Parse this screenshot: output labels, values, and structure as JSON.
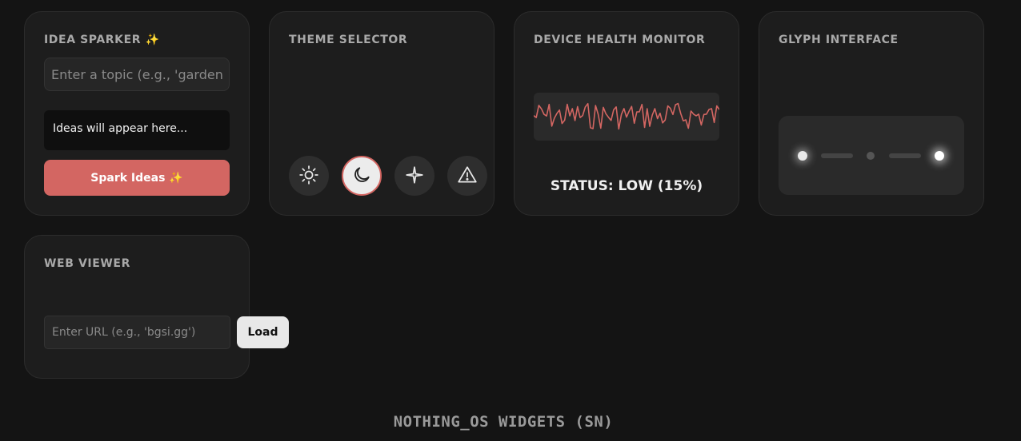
{
  "idea_sparker": {
    "title": "IDEA SPARKER ✨",
    "topic_placeholder": "Enter a topic (e.g., 'gardening')",
    "ideas_text": "Ideas will appear here...",
    "button_label": "Spark Ideas ✨",
    "accent_color": "#d36662"
  },
  "theme_selector": {
    "title": "THEME SELECTOR",
    "options": [
      {
        "icon": "sun-icon",
        "active": false
      },
      {
        "icon": "moon-icon",
        "active": true
      },
      {
        "icon": "sparkle-icon",
        "active": false
      },
      {
        "icon": "warning-icon",
        "active": false
      }
    ]
  },
  "device_health": {
    "title": "DEVICE HEALTH MONITOR",
    "status": "STATUS: LOW (15%)",
    "line_color": "#d36662"
  },
  "glyph_interface": {
    "title": "GLYPH INTERFACE"
  },
  "web_viewer": {
    "title": "WEB VIEWER",
    "url_placeholder": "Enter URL (e.g., 'bgsi.gg')",
    "load_label": "Load"
  },
  "footer": {
    "text": "NOTHING_OS WIDGETS (SN)"
  }
}
